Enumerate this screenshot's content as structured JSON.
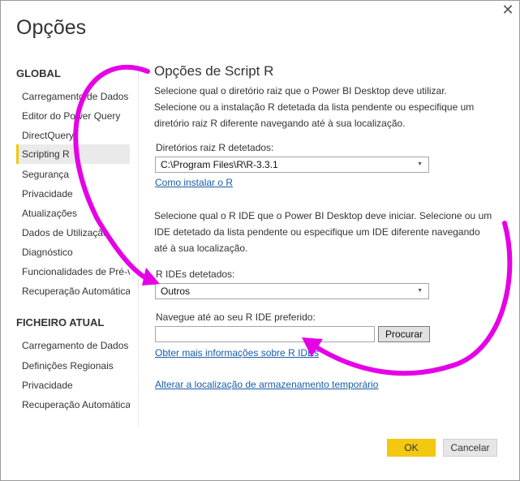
{
  "window": {
    "close_glyph": "✕"
  },
  "dialog_title": "Opções",
  "sidebar": {
    "global_heading": "GLOBAL",
    "global_items": [
      "Carregamento de Dados",
      "Editor do Power Query",
      "DirectQuery",
      "Scripting R",
      "Segurança",
      "Privacidade",
      "Atualizações",
      "Dados de Utilização",
      "Diagnóstico",
      "Funcionalidades de Pré-visualização",
      "Recuperação Automática"
    ],
    "selected_item": "Scripting R",
    "file_heading": "FICHEIRO ATUAL",
    "file_items": [
      "Carregamento de Dados",
      "Definições Regionais",
      "Privacidade",
      "Recuperação Automática"
    ]
  },
  "content": {
    "title": "Opções de Script R",
    "intro_lines": [
      "Selecione qual o diretório raiz que o Power BI Desktop deve utilizar.",
      "Selecione ou a instalação R detetada da lista pendente ou especifique um",
      "diretório raiz R diferente navegando até à sua localização."
    ],
    "root_label": "Diretórios raiz R detetados:",
    "root_value": "C:\\Program Files\\R\\R-3.3.1",
    "install_link": "Como instalar o R",
    "ide_lines": [
      "Selecione qual o R IDE que o Power BI Desktop deve iniciar. Selecione ou um",
      "IDE detetado da lista pendente ou especifique um IDE diferente navegando",
      "até à sua localização."
    ],
    "ide_label": "R IDEs detetados:",
    "ide_value": "Outros",
    "browse_label": "Navegue até ao seu R IDE preferido:",
    "browse_value": "",
    "browse_button": "Procurar",
    "more_info_link": "Obter mais informações sobre R IDEs",
    "temp_storage_link": "Alterar a localização de armazenamento temporário"
  },
  "footer": {
    "ok": "OK",
    "cancel": "Cancelar"
  },
  "colors": {
    "accent": "#f2c811",
    "link": "#1a5ca8",
    "annotation": "#e600e6"
  }
}
